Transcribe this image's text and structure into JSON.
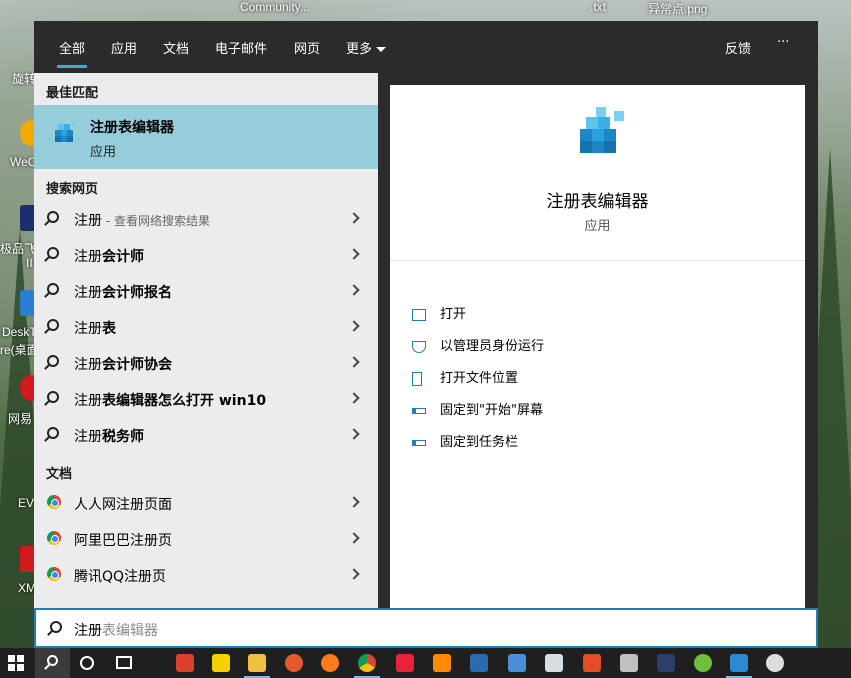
{
  "desktop": {
    "top_labels": [
      "Community...",
      ".txt",
      "异常点.png"
    ],
    "left_labels": [
      "旋转",
      "WeC",
      "极品飞",
      "II",
      "DeskT",
      "re(桌面",
      "网易",
      "EV",
      "XM"
    ]
  },
  "start_menu": {
    "tabs": [
      {
        "label": "全部",
        "active": true
      },
      {
        "label": "应用"
      },
      {
        "label": "文档"
      },
      {
        "label": "电子邮件"
      },
      {
        "label": "网页"
      },
      {
        "label": "更多"
      }
    ],
    "feedback_label": "反馈",
    "more_options_label": "···",
    "best_match": {
      "heading": "最佳匹配",
      "title": "注册表编辑器",
      "subtitle": "应用",
      "icon": "registry-editor-icon"
    },
    "web_search": {
      "heading": "搜索网页",
      "items": [
        {
          "prefix": "注册",
          "bold": "",
          "hint": " - 查看网络搜索结果"
        },
        {
          "prefix": "注册",
          "bold": "会计师",
          "hint": ""
        },
        {
          "prefix": "注册",
          "bold": "会计师报名",
          "hint": ""
        },
        {
          "prefix": "注册",
          "bold": "表",
          "hint": ""
        },
        {
          "prefix": "注册",
          "bold": "会计师协会",
          "hint": ""
        },
        {
          "prefix": "注册",
          "bold": "表编辑器怎么打开 win10",
          "hint": ""
        },
        {
          "prefix": "注册",
          "bold": "税务师",
          "hint": ""
        }
      ]
    },
    "documents": {
      "heading": "文档",
      "items": [
        {
          "label": "人人网注册页面"
        },
        {
          "label": "阿里巴巴注册页"
        },
        {
          "label": "腾讯QQ注册页"
        }
      ]
    },
    "detail": {
      "title": "注册表编辑器",
      "subtitle": "应用",
      "actions": [
        {
          "label": "打开",
          "icon": "open-icon"
        },
        {
          "label": "以管理员身份运行",
          "icon": "shield-icon"
        },
        {
          "label": "打开文件位置",
          "icon": "file-location-icon"
        },
        {
          "label": "固定到\"开始\"屏幕",
          "icon": "pin-icon"
        },
        {
          "label": "固定到任务栏",
          "icon": "pin-icon"
        }
      ]
    },
    "search": {
      "typed": "注册",
      "suggestion": "表编辑器"
    }
  },
  "colors": {
    "accent": "#1b7fbc",
    "highlight": "#96cddb",
    "menu_dark": "#2b2b2b",
    "list_bg": "#ececec"
  }
}
